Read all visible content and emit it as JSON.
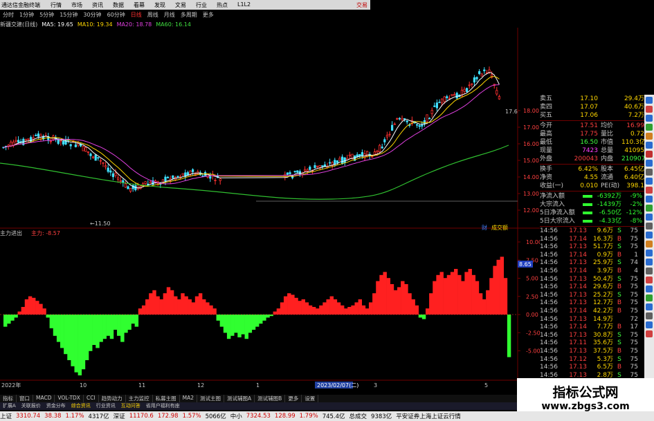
{
  "topbar": {
    "app_title": "通达信金融终端",
    "menu": [
      "行情",
      "市场",
      "资讯",
      "数据",
      "看幕",
      "发现",
      "文易",
      "行业",
      "热点",
      "L1L2"
    ],
    "right_label": "交易"
  },
  "periodbar": {
    "items": [
      "分时",
      "1分钟",
      "5分钟",
      "15分钟",
      "30分钟",
      "60分钟",
      "日线",
      "周线",
      "月线",
      "多周期",
      "更多"
    ],
    "active_index": 6
  },
  "ma_legend": {
    "title": "新疆交建(日线)",
    "items": [
      {
        "label": "MA5: 19.65",
        "color": "#ffffff"
      },
      {
        "label": "MA10: 19.34",
        "color": "#ffd700"
      },
      {
        "label": "MA20: 18.78",
        "color": "#e040e0"
      },
      {
        "label": "MA60: 16.14",
        "color": "#40e040"
      }
    ]
  },
  "kline": {
    "y_ticks": [
      "18.00",
      "17.00",
      "16.00",
      "15.00",
      "14.00",
      "13.00",
      "12.00"
    ],
    "last_price_tag": "17.6",
    "low_marker": "11.50"
  },
  "indicator": {
    "title": "主力进出",
    "param_label": "主力: -8.57",
    "y_ticks": [
      "10.00",
      "7.50",
      "5.00",
      "2.50",
      "0.00",
      "-2.50",
      "-5.00"
    ],
    "value_tag": "8.65",
    "side_tags": [
      "财",
      "成交额"
    ]
  },
  "date_axis": {
    "labels": [
      "2022年",
      "10",
      "11",
      "12",
      "1",
      "3",
      "5"
    ],
    "cursor_date": "2023/02/07(二)"
  },
  "quote": {
    "rows": [
      {
        "l": "卖五",
        "v": "17.10",
        "l2": "",
        "v2": "29.4万"
      },
      {
        "l": "卖四",
        "v": "17.07",
        "l2": "",
        "v2": "40.6万"
      },
      {
        "l": "买五",
        "v": "17.06",
        "l2": "",
        "v2": "7.2万"
      }
    ],
    "stats": [
      {
        "l": "今开",
        "v": "17.51",
        "l2": "均价",
        "v2": "16.99"
      },
      {
        "l": "最高",
        "v": "17.75",
        "l2": "量比",
        "v2": "0.72"
      },
      {
        "l": "最低",
        "v": "16.50",
        "l2": "市值",
        "v2": "110.3亿"
      },
      {
        "l": "现量",
        "v": "7423",
        "l2": "总量",
        "v2": "41095"
      },
      {
        "l": "外盘",
        "v": "200043",
        "l2": "内盘",
        "v2": "210907"
      }
    ],
    "stats2": [
      {
        "l": "换手",
        "v": "6.42%",
        "l2": "股本",
        "v2": "6.45亿"
      },
      {
        "l": "净资",
        "v": "4.55",
        "l2": "流通",
        "v2": "6.40亿"
      },
      {
        "l": "收益(一)",
        "v": "0.010",
        "l2": "PE(动)",
        "v2": "398.1"
      }
    ],
    "flows": [
      {
        "l": "净流入额",
        "v": "-6392万",
        "pct": "-9%"
      },
      {
        "l": "大宗流入",
        "v": "-1439万",
        "pct": "-2%"
      },
      {
        "l": "5日净流入额",
        "v": "-6.50亿",
        "pct": "-12%"
      },
      {
        "l": "5日大宗流入",
        "v": "-4.33亿",
        "pct": "-8%"
      }
    ]
  },
  "ticks": [
    {
      "t": "14:56",
      "p": "17.13",
      "vol": "9.6万",
      "bs": "S",
      "n": "75"
    },
    {
      "t": "14:56",
      "p": "17.14",
      "vol": "16.3万",
      "bs": "B",
      "n": "75"
    },
    {
      "t": "14:56",
      "p": "17.13",
      "vol": "51.7万",
      "bs": "S",
      "n": "75"
    },
    {
      "t": "14:56",
      "p": "17.14",
      "vol": "0.9万",
      "bs": "B",
      "n": "1"
    },
    {
      "t": "14:56",
      "p": "17.13",
      "vol": "25.9万",
      "bs": "S",
      "n": "74"
    },
    {
      "t": "14:56",
      "p": "17.14",
      "vol": "3.9万",
      "bs": "B",
      "n": "4"
    },
    {
      "t": "14:56",
      "p": "17.13",
      "vol": "50.4万",
      "bs": "S",
      "n": "75"
    },
    {
      "t": "14:56",
      "p": "17.14",
      "vol": "29.6万",
      "bs": "B",
      "n": "75"
    },
    {
      "t": "14:56",
      "p": "17.13",
      "vol": "25.2万",
      "bs": "S",
      "n": "75"
    },
    {
      "t": "14:56",
      "p": "17.13",
      "vol": "12.7万",
      "bs": "B",
      "n": "75"
    },
    {
      "t": "14:56",
      "p": "17.14",
      "vol": "42.2万",
      "bs": "B",
      "n": "75"
    },
    {
      "t": "14:56",
      "p": "17.13",
      "vol": "14.9万",
      "bs": "",
      "n": "72"
    },
    {
      "t": "14:56",
      "p": "17.14",
      "vol": "7.7万",
      "bs": "B",
      "n": "17"
    },
    {
      "t": "14:56",
      "p": "17.13",
      "vol": "30.8万",
      "bs": "S",
      "n": "75"
    },
    {
      "t": "14:56",
      "p": "17.11",
      "vol": "35.6万",
      "bs": "S",
      "n": "75"
    },
    {
      "t": "14:56",
      "p": "17.13",
      "vol": "37.5万",
      "bs": "B",
      "n": "75"
    },
    {
      "t": "14:56",
      "p": "17.12",
      "vol": "5.3万",
      "bs": "S",
      "n": "75"
    },
    {
      "t": "14:56",
      "p": "17.13",
      "vol": "6.5万",
      "bs": "B",
      "n": "75"
    },
    {
      "t": "14:56",
      "p": "17.13",
      "vol": "2.8万",
      "bs": "S",
      "n": "75"
    }
  ],
  "tabs": [
    "指标",
    "窗口",
    "MACD",
    "VOL-TDX",
    "CCI",
    "趋势动力",
    "主力监控",
    "私募主图",
    "MA2",
    "测试主图",
    "测试辅图A",
    "测试辅图B",
    "更多",
    "设置"
  ],
  "subtabs": [
    {
      "label": "扩展A",
      "hl": false
    },
    {
      "label": "关联报价",
      "hl": false
    },
    {
      "label": "资金分布",
      "hl": false
    },
    {
      "label": "综合资讯",
      "hl": true
    },
    {
      "label": "行业资讯",
      "hl": false
    },
    {
      "label": "互动问答",
      "hl": true
    },
    {
      "label": "省用户福利有座",
      "hl": false
    }
  ],
  "status": {
    "items": [
      {
        "label": "上证",
        "value": "3310.74",
        "chg": "38.38",
        "pct": "1.17%",
        "amt": "4317亿"
      },
      {
        "label": "深证",
        "value": "11170.6",
        "chg": "172.98",
        "pct": "1.57%",
        "amt": "5066亿"
      },
      {
        "label": "中小",
        "value": "7324.53",
        "chg": "128.99",
        "pct": "1.79%",
        "amt": "745.4亿"
      }
    ],
    "total_label": "总成交",
    "total_value": "9383亿",
    "broker": "平安证券上海上证云行情"
  },
  "watermark": {
    "line1": "指标公式网",
    "line2": "www.zbgs3.com"
  },
  "colors": {
    "up": "#ff3030",
    "down": "#30ff30",
    "bg": "#000000",
    "grid": "#700000"
  }
}
